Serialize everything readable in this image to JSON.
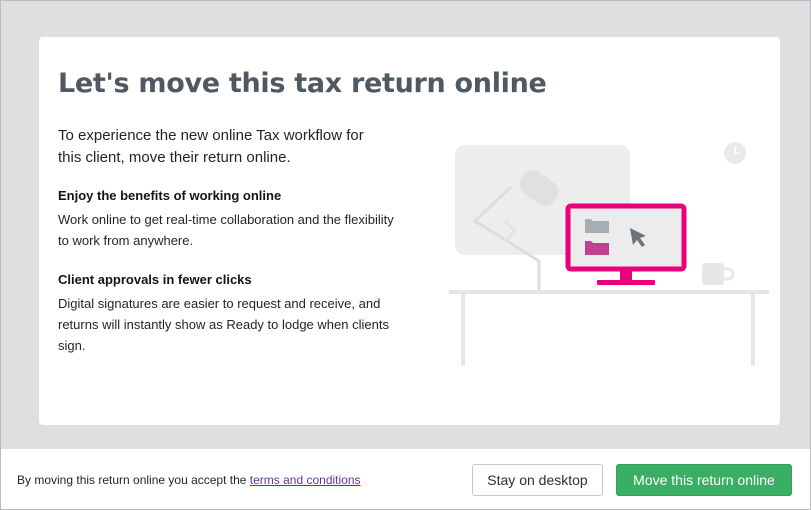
{
  "dialog": {
    "title": "Let's move this tax return online",
    "intro": "To experience the new online Tax workflow for this client, move their return online.",
    "benefits": [
      {
        "heading": "Enjoy the benefits of working online",
        "body": "Work online to get real-time collaboration and the flexibility to work from anywhere."
      },
      {
        "heading": "Client approvals in fewer clicks",
        "body": "Digital signatures are easier to request and receive, and returns will instantly show as Ready to lodge when clients sign."
      }
    ],
    "illustration": {
      "icon": "desk-computer-illustration",
      "accent_color": "#e8007d",
      "muted_color": "#e8e9ea"
    }
  },
  "footer": {
    "notice_prefix": "By moving this return online you accept the ",
    "terms_link": "terms and conditions",
    "stay_button": "Stay on desktop",
    "move_button": "Move this return online",
    "primary_color": "#3aae63"
  }
}
